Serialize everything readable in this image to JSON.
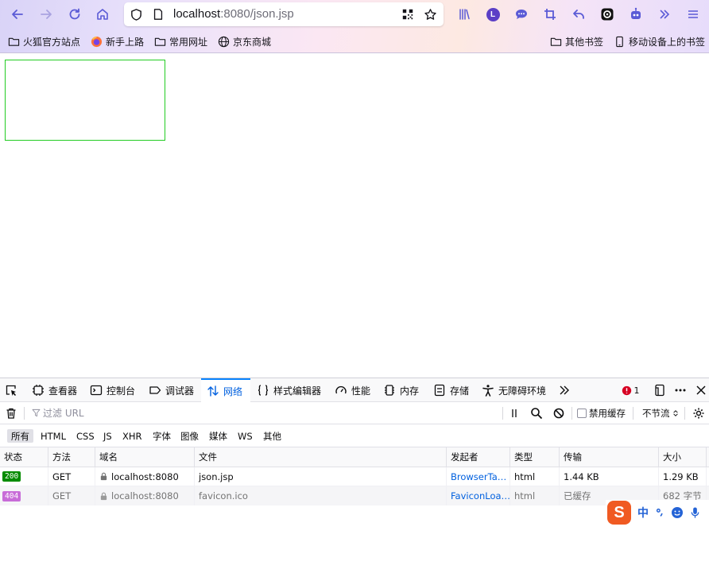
{
  "browser": {
    "url_host": "localhost",
    "url_rest": ":8080/json.jsp",
    "bookmarks": [
      {
        "label": "火狐官方站点",
        "icon": "folder-icon"
      },
      {
        "label": "新手上路",
        "icon": "firefox-icon"
      },
      {
        "label": "常用网址",
        "icon": "folder-icon"
      },
      {
        "label": "京东商城",
        "icon": "globe-icon"
      }
    ],
    "bookmarks_right": [
      {
        "label": "其他书签",
        "icon": "folder-icon"
      },
      {
        "label": "移动设备上的书签",
        "icon": "mobile-icon"
      }
    ],
    "profile_initial": "L"
  },
  "devtools": {
    "tabs": [
      {
        "label": "查看器",
        "icon": "inspector-icon"
      },
      {
        "label": "控制台",
        "icon": "console-icon"
      },
      {
        "label": "调试器",
        "icon": "debugger-icon"
      },
      {
        "label": "网络",
        "icon": "network-icon",
        "active": true
      },
      {
        "label": "样式编辑器",
        "icon": "braces-icon"
      },
      {
        "label": "性能",
        "icon": "gauge-icon"
      },
      {
        "label": "内存",
        "icon": "memory-icon"
      },
      {
        "label": "存储",
        "icon": "storage-icon"
      },
      {
        "label": "无障碍环境",
        "icon": "accessibility-icon"
      }
    ],
    "error_count": "1",
    "filter": {
      "placeholder": "过滤 URL",
      "disable_cache_label": "禁用缓存",
      "throttle_label": "不节流",
      "disable_cache_checked": false
    },
    "type_filters": [
      "所有",
      "HTML",
      "CSS",
      "JS",
      "XHR",
      "字体",
      "图像",
      "媒体",
      "WS",
      "其他"
    ],
    "columns": [
      "状态",
      "方法",
      "域名",
      "文件",
      "发起者",
      "类型",
      "传输",
      "大小"
    ],
    "requests": [
      {
        "status": "200",
        "status_color": "#058b00",
        "method": "GET",
        "domain": "localhost:8080",
        "file": "json.jsp",
        "initiator": "BrowserTa…",
        "type": "html",
        "transferred": "1.44 KB",
        "size": "1.29 KB"
      },
      {
        "status": "404",
        "status_color": "#c86cd8",
        "method": "GET",
        "domain": "localhost:8080",
        "file": "favicon.ico",
        "initiator": "FaviconLoa…",
        "type": "html",
        "transferred": "已缓存",
        "size": "682 字节"
      }
    ]
  },
  "ime": {
    "logo": "S",
    "mode": "中"
  },
  "colors": {
    "accent": "#0a84ff",
    "green_box": "#22cc22"
  }
}
